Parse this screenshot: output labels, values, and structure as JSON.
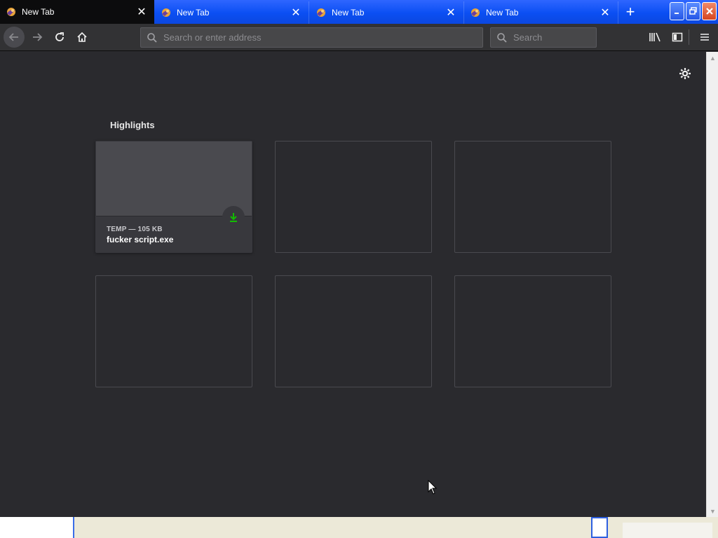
{
  "tabs": [
    {
      "label": "New Tab",
      "active": true
    },
    {
      "label": "New Tab",
      "active": false
    },
    {
      "label": "New Tab",
      "active": false
    },
    {
      "label": "New Tab",
      "active": false
    }
  ],
  "toolbar": {
    "url_placeholder": "Search or enter address",
    "search_placeholder": "Search"
  },
  "highlights": {
    "title": "Highlights",
    "cards": [
      {
        "meta": "TEMP — 105 KB",
        "filename": "fucker script.exe",
        "type": "download"
      }
    ]
  },
  "colors": {
    "tabstrip_blue": "#0b4ff3",
    "content_bg": "#2a2a2e",
    "download_green": "#12bc00"
  }
}
